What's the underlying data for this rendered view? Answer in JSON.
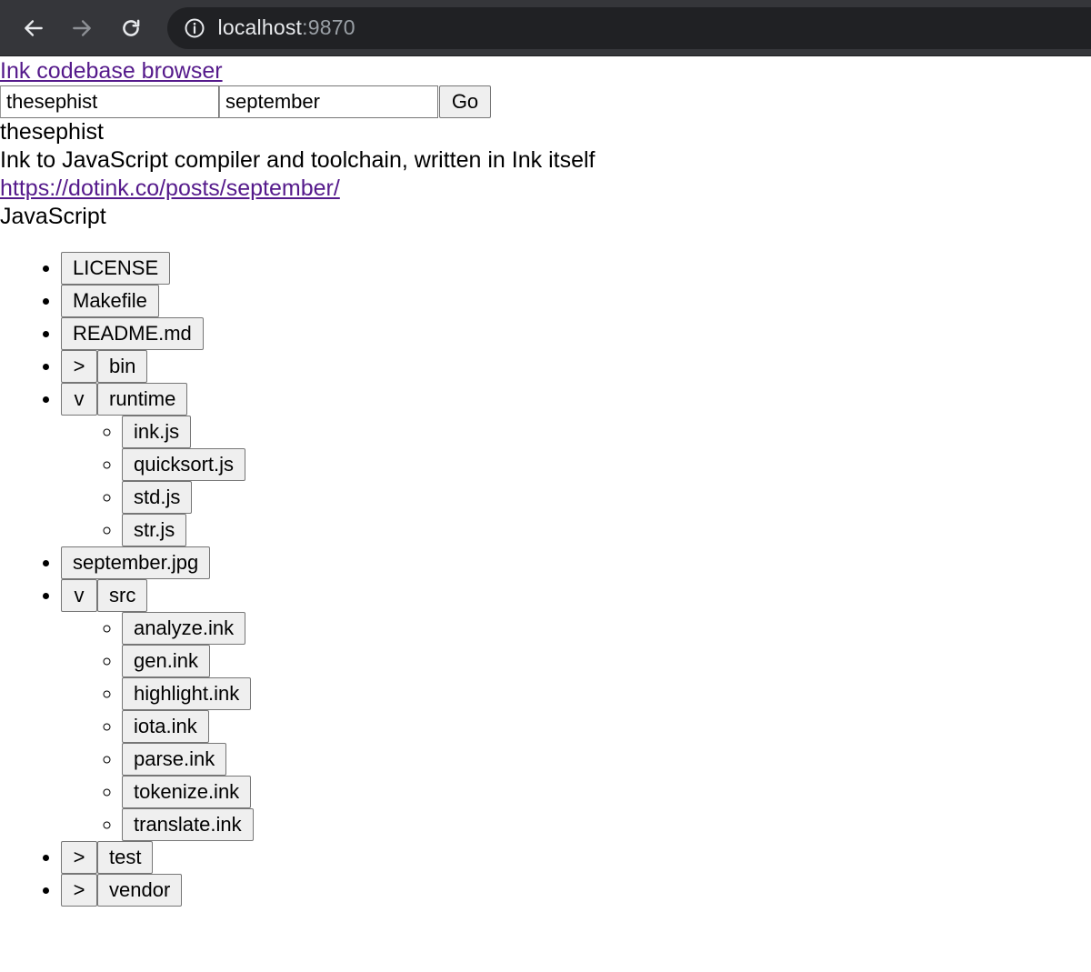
{
  "browser": {
    "url_host": "localhost",
    "url_port": ":9870"
  },
  "header": {
    "home_link": "Ink codebase browser"
  },
  "search": {
    "user_value": "thesephist",
    "repo_value": "september",
    "go_label": "Go"
  },
  "repo": {
    "owner": "thesephist",
    "description": "Ink to JavaScript compiler and toolchain, written in Ink itself",
    "homepage": "https://dotink.co/posts/september/",
    "language": "JavaScript"
  },
  "tree": {
    "items": [
      {
        "label": "LICENSE"
      },
      {
        "label": "Makefile"
      },
      {
        "label": "README.md"
      },
      {
        "label": "bin",
        "toggle": ">"
      },
      {
        "label": "runtime",
        "toggle": "v",
        "children": [
          {
            "label": "ink.js"
          },
          {
            "label": "quicksort.js"
          },
          {
            "label": "std.js"
          },
          {
            "label": "str.js"
          }
        ]
      },
      {
        "label": "september.jpg"
      },
      {
        "label": "src",
        "toggle": "v",
        "children": [
          {
            "label": "analyze.ink"
          },
          {
            "label": "gen.ink"
          },
          {
            "label": "highlight.ink"
          },
          {
            "label": "iota.ink"
          },
          {
            "label": "parse.ink"
          },
          {
            "label": "tokenize.ink"
          },
          {
            "label": "translate.ink"
          }
        ]
      },
      {
        "label": "test",
        "toggle": ">"
      },
      {
        "label": "vendor",
        "toggle": ">"
      }
    ]
  },
  "icons": {
    "back": "arrow-left-icon",
    "forward": "arrow-right-icon",
    "reload": "reload-icon",
    "info": "info-circle-icon"
  }
}
